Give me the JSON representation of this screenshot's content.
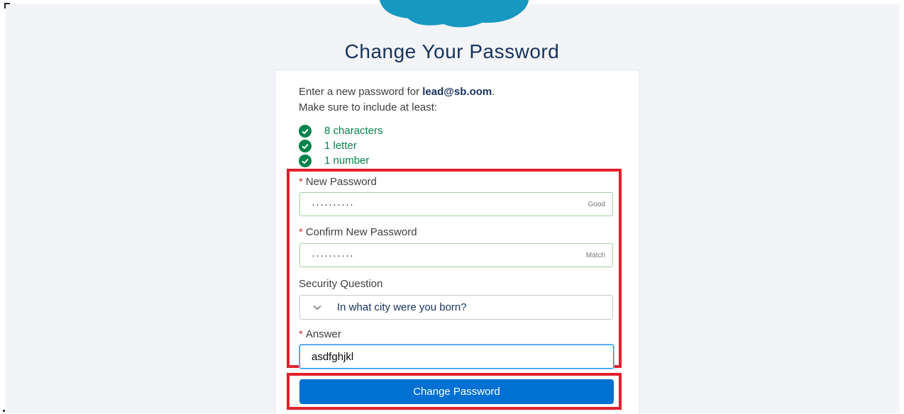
{
  "page": {
    "title": "Change Your Password",
    "brand_color": "#1798c1"
  },
  "intro": {
    "prefix": "Enter a new password for ",
    "username": "lead@sb.oom",
    "suffix": ".",
    "line2": "Make sure to include at least:"
  },
  "requirements": [
    {
      "label": "8 characters",
      "icon": "check-circle-icon",
      "status": "met"
    },
    {
      "label": "1 letter",
      "icon": "check-circle-icon",
      "status": "met"
    },
    {
      "label": "1 number",
      "icon": "check-circle-icon",
      "status": "met"
    }
  ],
  "form": {
    "new_password": {
      "label": "New Password",
      "required_marker": "*",
      "value": "··········",
      "hint": "Good"
    },
    "confirm_password": {
      "label": "Confirm New Password",
      "required_marker": "*",
      "value": "··········",
      "hint": "Match"
    },
    "security_question": {
      "label": "Security Question",
      "selected": "In what city were you born?"
    },
    "answer": {
      "label": "Answer",
      "required_marker": "*",
      "value": "asdfghjkl"
    },
    "submit_label": "Change Password"
  },
  "colors": {
    "success": "#04844b",
    "highlight": "#e2202c",
    "primary_button": "#0070d2"
  }
}
